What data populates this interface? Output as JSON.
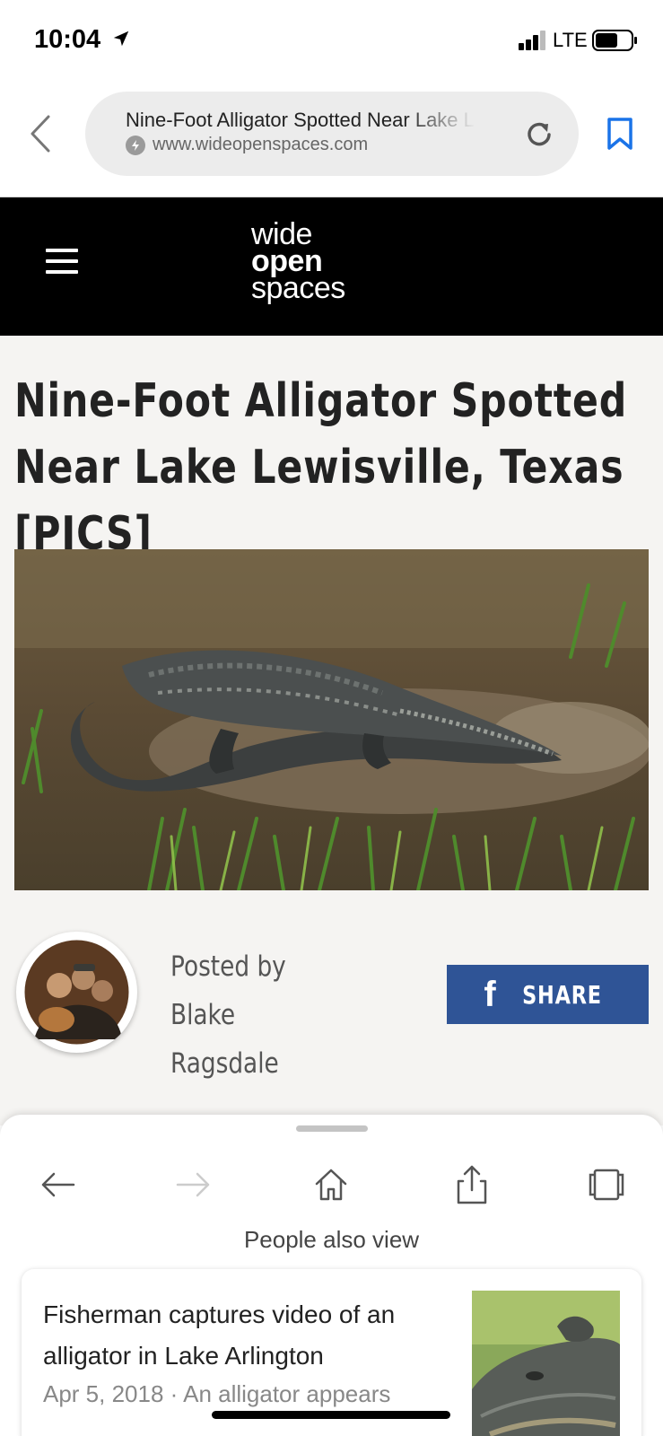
{
  "status_bar": {
    "time": "10:04",
    "network": "LTE"
  },
  "browser": {
    "page_title": "Nine-Foot Alligator Spotted Near Lake Lewisville, Texas [PICS]",
    "host": "www.wideopenspaces.com",
    "icons": [
      "back-chevron-icon",
      "bolt-icon",
      "reload-icon",
      "bookmark-icon"
    ]
  },
  "site": {
    "logo_line1": "wide",
    "logo_line2": "open",
    "logo_line3": "spaces"
  },
  "article": {
    "title": "Nine-Foot Alligator Spotted Near Lake Lewisville, Texas [PICS]",
    "posted_by_label": "Posted by",
    "author_first": "Blake",
    "author_last": "Ragsdale",
    "share_label": "SHARE",
    "share_icon": "f"
  },
  "bottom_sheet": {
    "section_label": "People also view",
    "toolbar": [
      "back-arrow-icon",
      "forward-arrow-icon",
      "home-icon",
      "share-icon",
      "tabs-icon"
    ],
    "recommendation": {
      "title": "Fisherman captures video of an alligator in Lake Arlington",
      "meta": "Apr 5, 2018 · An alligator appears"
    }
  },
  "colors": {
    "header_bg": "#000000",
    "article_bg": "#f5f4f2",
    "facebook_blue": "#2f5496",
    "bookmark_blue": "#1a73e8"
  }
}
